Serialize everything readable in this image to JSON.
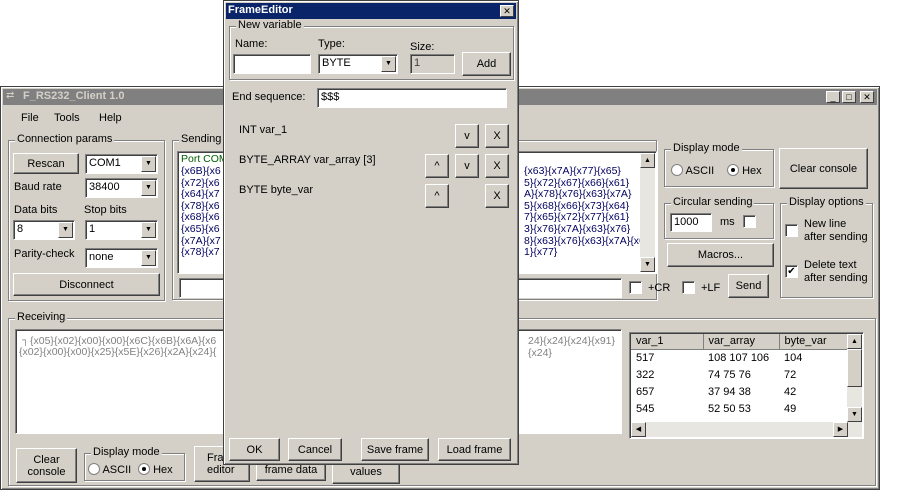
{
  "main_window": {
    "title": "F_RS232_Client 1.0",
    "menu": [
      "File",
      "Tools",
      "Help"
    ]
  },
  "connection": {
    "group_label": "Connection params",
    "rescan_label": "Rescan",
    "port_value": "COM1",
    "baud_label": "Baud rate",
    "baud_value": "38400",
    "databits_label": "Data bits",
    "databits_value": "8",
    "stopbits_label": "Stop bits",
    "stopbits_value": "1",
    "parity_label": "Parity-check",
    "parity_value": "none",
    "disconnect_label": "Disconnect"
  },
  "sending": {
    "group_label": "Sending",
    "port_line": "Port COM",
    "left_lines": [
      "{x6B}{x6",
      "{x72}{x6",
      "{x64}{x7",
      "{x78}{x6",
      "{x68}{x6",
      "{x65}{x6",
      "{x7A}{x7",
      "{x78}{x7"
    ],
    "right_lines": [
      "{x63}{x7A}{x77}{x65}",
      "5}{x72}{x67}{x66}{x61}",
      "A}{x78}{x76}{x63}{x7A}",
      "5}{x68}{x66}{x73}{x64}",
      "7}{x65}{x72}{x77}{x61}",
      "3}{x76}{x7A}{x63}{x76}",
      "8}{x63}{x76}{x63}{x7A}{x63}",
      "1}{x77}"
    ],
    "cr_label": "+CR",
    "lf_label": "+LF",
    "send_label": "Send"
  },
  "display_mode": {
    "label": "Display mode",
    "ascii": "ASCII",
    "hex": "Hex",
    "selected": "Hex"
  },
  "clear_console_label": "Clear console",
  "circular": {
    "label": "Circular sending",
    "value": "1000",
    "unit": "ms"
  },
  "macros_label": "Macros...",
  "display_options": {
    "label": "Display options",
    "new_line": [
      "New line",
      "after sending"
    ],
    "new_line_checked": false,
    "delete_text": [
      "Delete text",
      "after sending"
    ],
    "delete_text_checked": true
  },
  "receiving": {
    "label": "Receiving",
    "left_lines": [
      "{x05}{x02}{x00}{x00}{x6C}{x6B}{x6A}{x6",
      "{x02}{x00}{x00}{x25}{x5E}{x26}{x2A}{x24}{"
    ],
    "right_lines": [
      "24}{x24}{x24}{x91}",
      "{x24}"
    ],
    "table_headers": [
      "var_1",
      "var_array",
      "byte_var"
    ],
    "table_rows": [
      [
        "517",
        "108 107 106",
        "104"
      ],
      [
        "322",
        "74 75 76",
        "72"
      ],
      [
        "657",
        "37 94 38",
        "42"
      ],
      [
        "545",
        "52 50 53",
        "49"
      ]
    ]
  },
  "bottom": {
    "clear_console": [
      "Clear",
      "console"
    ],
    "display_mode_label": "Display mode",
    "ascii": "ASCII",
    "hex": "Hex",
    "frame_editor": [
      "Fra",
      "editor"
    ],
    "frame_data": "frame data",
    "values": "values"
  },
  "frame_editor": {
    "title": "FrameEditor",
    "new_variable_label": "New variable",
    "name_label": "Name:",
    "name_value": "",
    "type_label": "Type:",
    "type_value": "BYTE",
    "size_label": "Size:",
    "size_value": "1",
    "add_label": "Add",
    "end_sequence_label": "End sequence:",
    "end_sequence_value": "$$$",
    "variables": [
      {
        "name": "INT var_1",
        "up": "",
        "down": "v",
        "del": "X"
      },
      {
        "name": "BYTE_ARRAY var_array [3]",
        "up": "^",
        "down": "v",
        "del": "X"
      },
      {
        "name": "BYTE byte_var",
        "up": "^",
        "down": "",
        "del": "X"
      }
    ],
    "ok_label": "OK",
    "cancel_label": "Cancel",
    "save_label": "Save frame",
    "load_label": "Load frame"
  }
}
